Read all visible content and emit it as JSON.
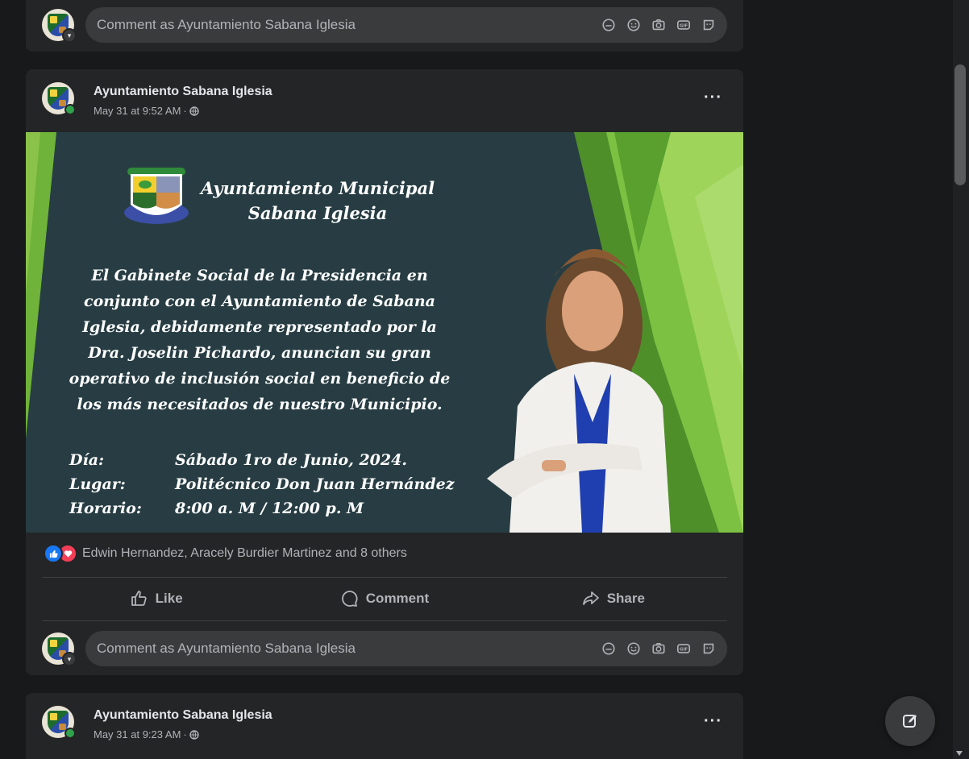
{
  "comment_placeholder": "Comment as Ayuntamiento Sabana Iglesia",
  "posts": [
    {
      "author": "Ayuntamiento Sabana Iglesia",
      "time": "May 31 at 9:52 AM",
      "more_label": "···",
      "flyer": {
        "title_line1": "Ayuntamiento Municipal",
        "title_line2": "Sabana Iglesia",
        "body_lines": [
          "El Gabinete Social de la Presidencia en",
          "conjunto con el Ayuntamiento de Sabana",
          "Iglesia, debidamente representado por la",
          "Dra. Joselin Pichardo, anuncian su gran",
          "operativo de inclusión social en beneficio de",
          "los más necesitados de nuestro Municipio."
        ],
        "details": [
          {
            "label": "Día:",
            "value": "Sábado 1ro de Junio, 2024."
          },
          {
            "label": "Lugar:",
            "value": "Politécnico Don Juan Hernández"
          },
          {
            "label": "Horario:",
            "value": "8:00 a. M / 12:00 p. M"
          }
        ]
      },
      "reactions_text": "Edwin Hernandez, Aracely Burdier Martinez and 8 others",
      "actions": {
        "like": "Like",
        "comment": "Comment",
        "share": "Share"
      }
    },
    {
      "author": "Ayuntamiento Sabana Iglesia",
      "time": "May 31 at 9:23 AM",
      "more_label": "···"
    }
  ],
  "icons": {
    "sticker": "sticker-icon",
    "emoji": "emoji-icon",
    "camera": "camera-icon",
    "gif": "gif-icon",
    "avatar_sticker": "avatar-sticker-icon",
    "globe": "globe-icon",
    "compose": "compose-icon"
  },
  "colors": {
    "background": "#18191a",
    "card": "#242526",
    "input": "#3a3b3c",
    "like_blue": "#1877f2",
    "love_red": "#f33e58",
    "flyer_bg": "#273d43",
    "flyer_green": "#7cc142"
  }
}
